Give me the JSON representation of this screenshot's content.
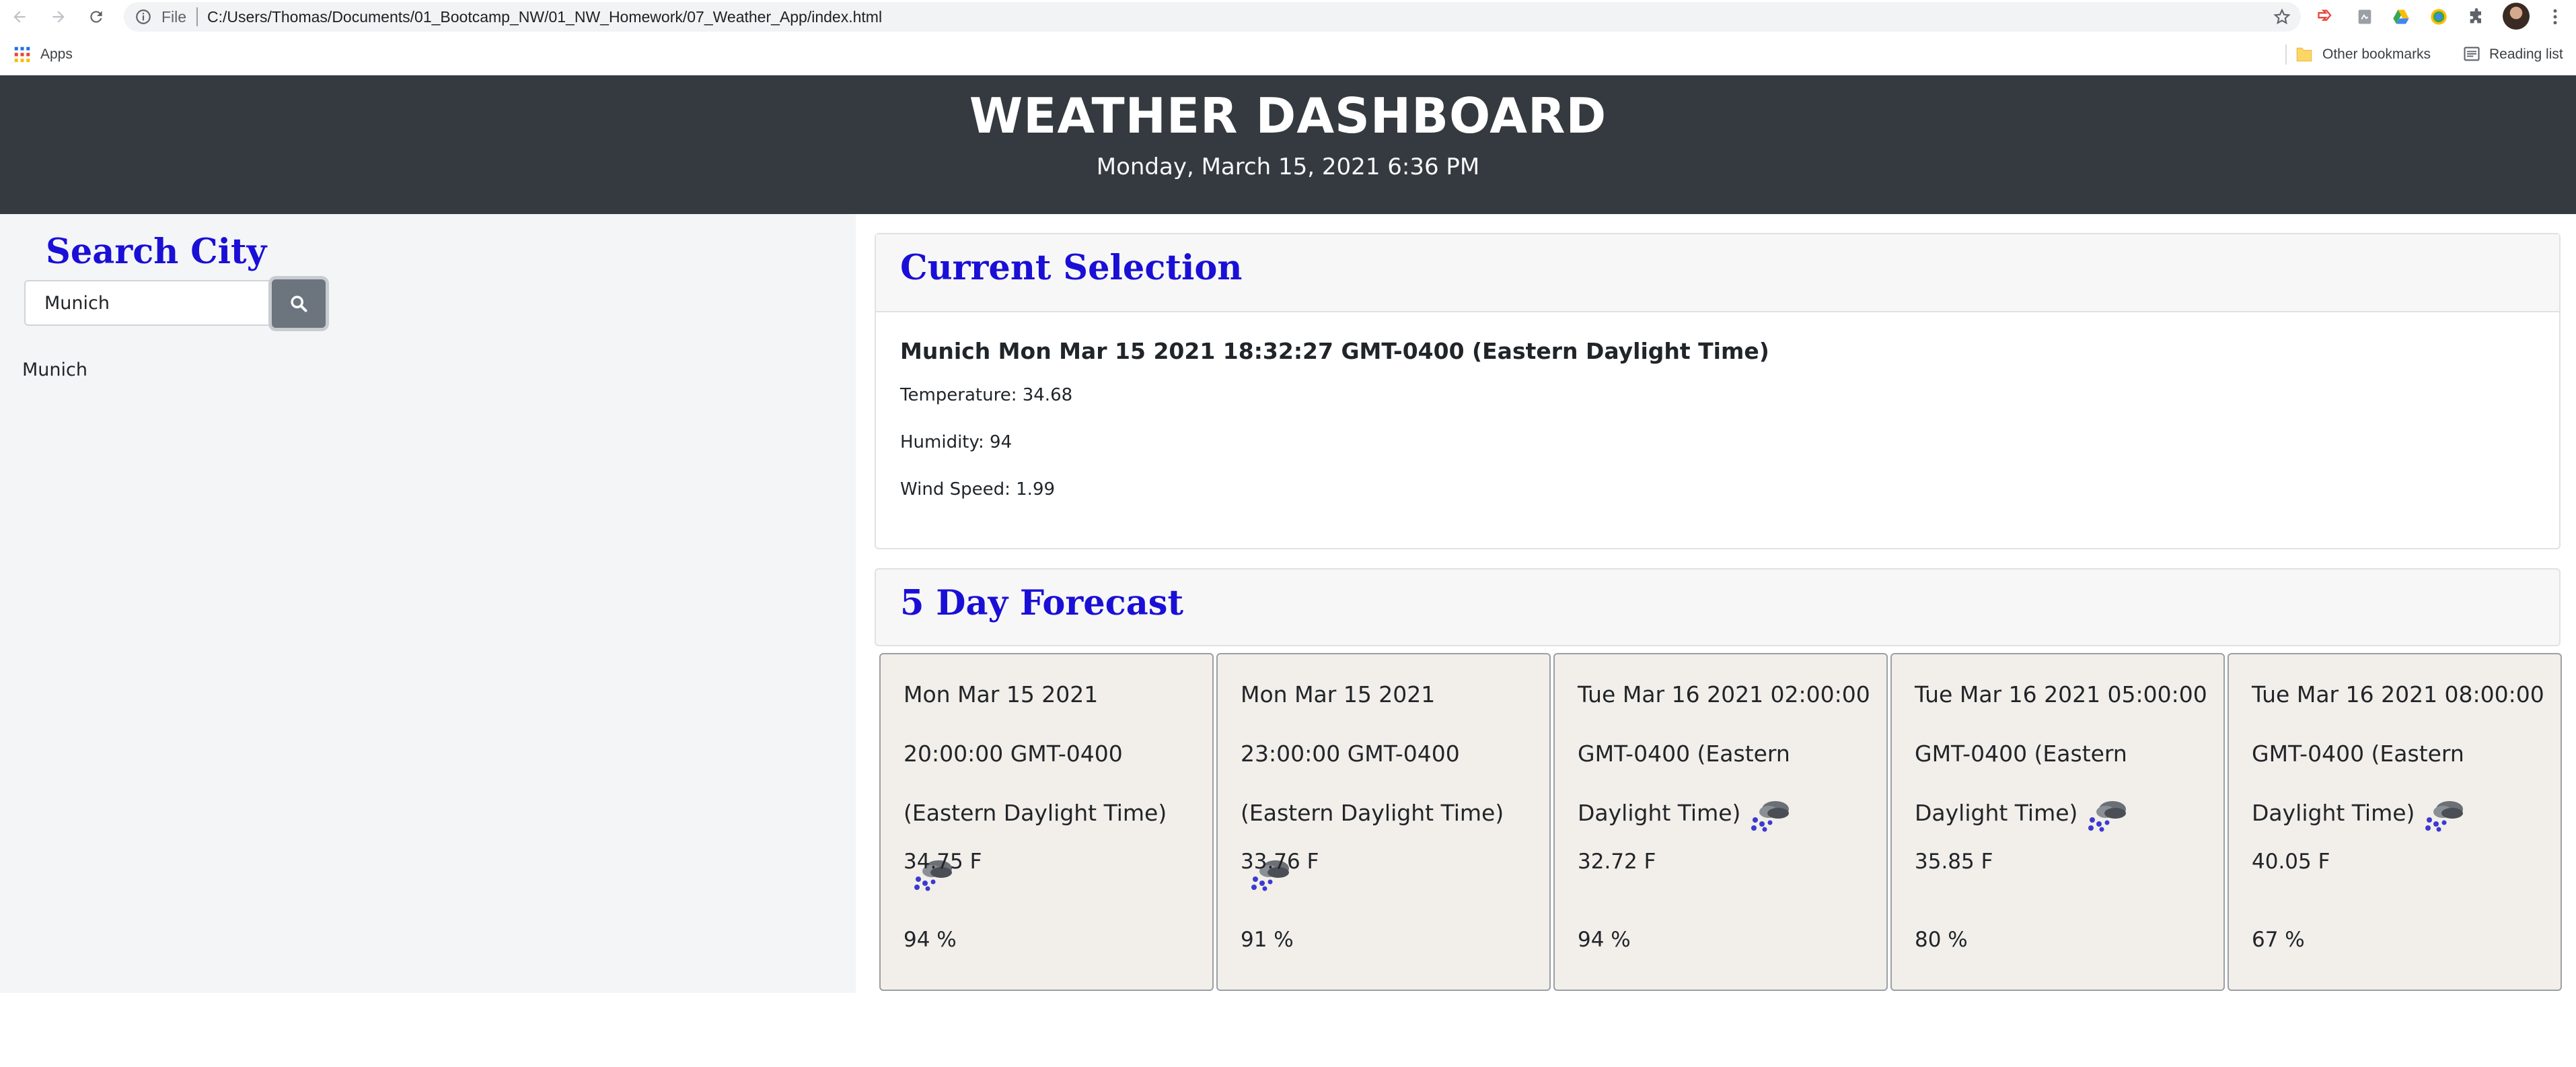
{
  "browser": {
    "file_label": "File",
    "url": "C:/Users/Thomas/Documents/01_Bootcamp_NW/01_NW_Homework/07_Weather_App/index.html",
    "bookmarks": {
      "apps_label": "Apps",
      "other_bookmarks_label": "Other bookmarks",
      "reading_list_label": "Reading list"
    }
  },
  "header": {
    "title": "WEATHER DASHBOARD",
    "date": "Monday, March 15, 2021 6:36 PM"
  },
  "sidebar": {
    "title": "Search City",
    "search_value": "Munich",
    "history": [
      "Munich"
    ]
  },
  "current": {
    "title": "Current Selection",
    "city_line": "Munich Mon Mar 15 2021 18:32:27 GMT-0400 (Eastern Daylight Time)",
    "temperature": "Temperature: 34.68",
    "humidity": "Humidity: 94",
    "wind": "Wind Speed: 1.99"
  },
  "forecast": {
    "title": "5 Day Forecast",
    "days": [
      {
        "date": "Mon Mar 15 2021 20:00:00 GMT-0400 (Eastern Daylight Time)",
        "temp": "34.75 F",
        "humidity": "94 %",
        "icon": "snow-cloud-icon"
      },
      {
        "date": "Mon Mar 15 2021 23:00:00 GMT-0400 (Eastern Daylight Time)",
        "temp": "33.76 F",
        "humidity": "91 %",
        "icon": "snow-cloud-icon"
      },
      {
        "date": "Tue Mar 16 2021 02:00:00 GMT-0400 (Eastern Daylight Time)",
        "temp": "32.72 F",
        "humidity": "94 %",
        "icon": "snow-cloud-icon"
      },
      {
        "date": "Tue Mar 16 2021 05:00:00 GMT-0400 (Eastern Daylight Time)",
        "temp": "35.85 F",
        "humidity": "80 %",
        "icon": "snow-cloud-icon"
      },
      {
        "date": "Tue Mar 16 2021 08:00:00 GMT-0400 (Eastern Daylight Time)",
        "temp": "40.05 F",
        "humidity": "67 %",
        "icon": "snow-cloud-icon"
      }
    ]
  },
  "colors": {
    "header_bg": "#343a40",
    "accent_title": "#1a0fd6",
    "sidebar_bg": "#f4f5f7",
    "forecast_card_bg": "#f2eeea",
    "search_button_bg": "#6c757d"
  }
}
